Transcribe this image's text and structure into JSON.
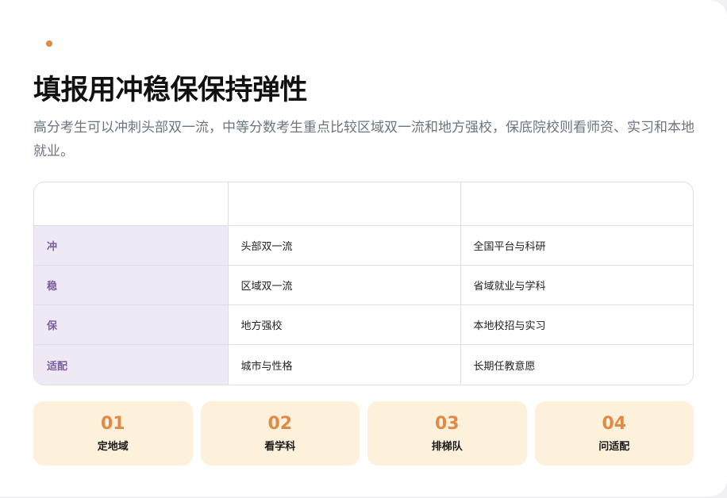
{
  "header": {
    "title": "填报用冲稳保保持弹性",
    "subtitle": "高分考生可以冲刺头部双一流，中等分数考生重点比较区域双一流和地方强校，保底院校则看师资、实习和本地就业。"
  },
  "table": {
    "headers": [
      "",
      "",
      ""
    ],
    "rows": [
      {
        "label": "冲",
        "col2": "头部双一流",
        "col3": "全国平台与科研"
      },
      {
        "label": "稳",
        "col2": "区域双一流",
        "col3": "省域就业与学科"
      },
      {
        "label": "保",
        "col2": "地方强校",
        "col3": "本地校招与实习"
      },
      {
        "label": "适配",
        "col2": "城市与性格",
        "col3": "长期任教意愿"
      }
    ]
  },
  "steps": [
    {
      "num": "01",
      "label": "定地域"
    },
    {
      "num": "02",
      "label": "看学科"
    },
    {
      "num": "03",
      "label": "排梯队"
    },
    {
      "num": "04",
      "label": "问适配"
    }
  ],
  "colors": {
    "accent": "#e08a45",
    "row_head_bg": "#efe9f5",
    "row_head_text": "#7d5e9e",
    "step_bg": "#fdf1dc"
  }
}
